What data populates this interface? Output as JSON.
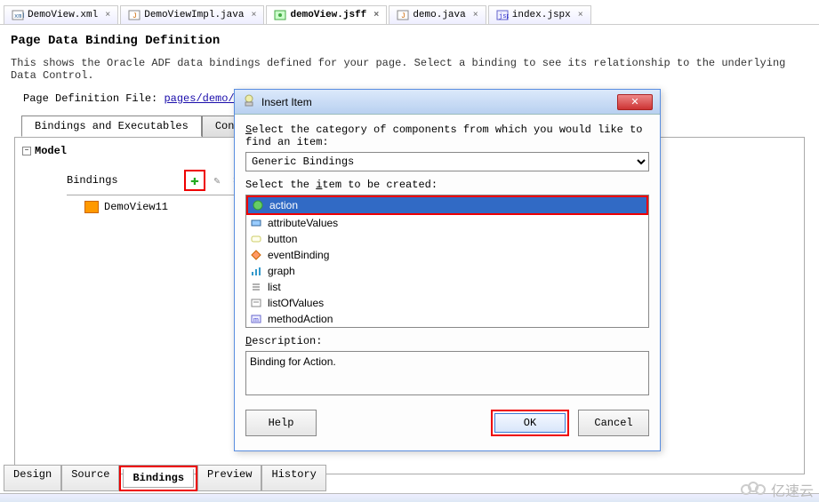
{
  "editor_tabs": [
    {
      "label": "DemoView.xml",
      "active": false
    },
    {
      "label": "DemoViewImpl.java",
      "active": false
    },
    {
      "label": "demoView.jsff",
      "active": true
    },
    {
      "label": "demo.java",
      "active": false
    },
    {
      "label": "index.jspx",
      "active": false
    }
  ],
  "page": {
    "title": "Page Data Binding Definition",
    "description": "This shows the Oracle ADF data bindings defined for your page. Select a binding to see its relationship to the underlying Data Control.",
    "def_file_label": "Page Definition File: ",
    "def_file_link": "pages/demo/demoViewPageDef.xml"
  },
  "inner_tabs": {
    "bindings": "Bindings and Executables",
    "contextual": "Contextual"
  },
  "tree": {
    "root": "Model",
    "bindings_label": "Bindings",
    "item": "DemoView11"
  },
  "dialog": {
    "title": "Insert Item",
    "category_label_pre": "S",
    "category_label_post": "elect the category of components from which you would like to find an item:",
    "category_value": "Generic Bindings",
    "item_label_pre": "Select the ",
    "item_label_u": "i",
    "item_label_post": "tem to be created:",
    "items": [
      "action",
      "attributeValues",
      "button",
      "eventBinding",
      "graph",
      "list",
      "listOfValues",
      "methodAction"
    ],
    "selected_item": "action",
    "desc_label_u": "D",
    "desc_label_post": "escription:",
    "description_text": "Binding for Action.",
    "help_btn_u": "H",
    "help_btn_post": "elp",
    "ok_btn": "OK",
    "cancel_btn": "Cancel"
  },
  "bottom_tabs": [
    "Design",
    "Source",
    "Bindings",
    "Preview",
    "History"
  ],
  "bottom_active": "Bindings",
  "watermark_text": "亿速云"
}
